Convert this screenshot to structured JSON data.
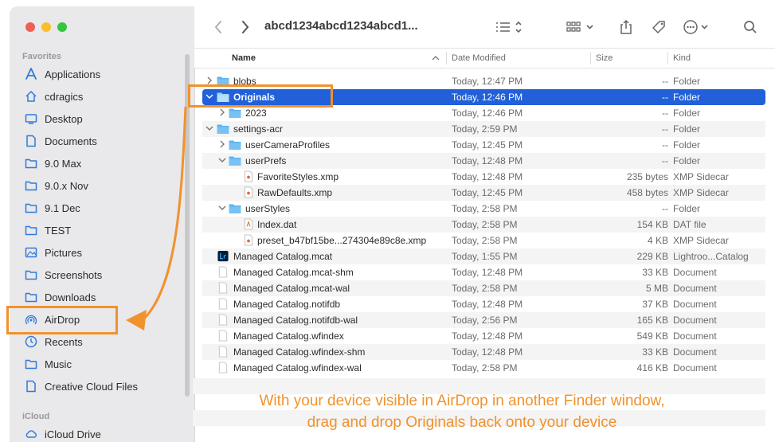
{
  "window": {
    "title": "abcd1234abcd1234abcd1..."
  },
  "sidebar": {
    "favorites_label": "Favorites",
    "icloud_label": "iCloud",
    "items": [
      {
        "label": "Applications",
        "icon": "applications-icon"
      },
      {
        "label": "cdragics",
        "icon": "home-icon"
      },
      {
        "label": "Desktop",
        "icon": "desktop-icon"
      },
      {
        "label": "Documents",
        "icon": "document-icon"
      },
      {
        "label": "9.0 Max",
        "icon": "folder-icon"
      },
      {
        "label": "9.0.x Nov",
        "icon": "folder-icon"
      },
      {
        "label": "9.1 Dec",
        "icon": "folder-icon"
      },
      {
        "label": "TEST",
        "icon": "folder-icon"
      },
      {
        "label": "Pictures",
        "icon": "pictures-icon"
      },
      {
        "label": "Screenshots",
        "icon": "folder-icon"
      },
      {
        "label": "Downloads",
        "icon": "folder-icon"
      },
      {
        "label": "AirDrop",
        "icon": "airdrop-icon"
      },
      {
        "label": "Recents",
        "icon": "clock-icon"
      },
      {
        "label": "Music",
        "icon": "folder-icon"
      },
      {
        "label": "Creative Cloud Files",
        "icon": "document-icon"
      }
    ],
    "icloud_items": [
      {
        "label": "iCloud Drive",
        "icon": "cloud-icon"
      }
    ]
  },
  "columns": {
    "name": "Name",
    "date": "Date Modified",
    "size": "Size",
    "kind": "Kind"
  },
  "files": [
    {
      "name": "blobs",
      "date": "Today, 12:47 PM",
      "size": "--",
      "kind": "Folder"
    },
    {
      "name": "Originals",
      "date": "Today, 12:46 PM",
      "size": "--",
      "kind": "Folder"
    },
    {
      "name": "2023",
      "date": "Today, 12:46 PM",
      "size": "--",
      "kind": "Folder"
    },
    {
      "name": "settings-acr",
      "date": "Today, 2:59 PM",
      "size": "--",
      "kind": "Folder"
    },
    {
      "name": "userCameraProfiles",
      "date": "Today, 12:45 PM",
      "size": "--",
      "kind": "Folder"
    },
    {
      "name": "userPrefs",
      "date": "Today, 12:48 PM",
      "size": "--",
      "kind": "Folder"
    },
    {
      "name": "FavoriteStyles.xmp",
      "date": "Today, 12:48 PM",
      "size": "235 bytes",
      "kind": "XMP Sidecar"
    },
    {
      "name": "RawDefaults.xmp",
      "date": "Today, 12:45 PM",
      "size": "458 bytes",
      "kind": "XMP Sidecar"
    },
    {
      "name": "userStyles",
      "date": "Today, 2:58 PM",
      "size": "--",
      "kind": "Folder"
    },
    {
      "name": "Index.dat",
      "date": "Today, 2:58 PM",
      "size": "154 KB",
      "kind": "DAT file"
    },
    {
      "name": "preset_b47bf15be...274304e89c8e.xmp",
      "date": "Today, 2:58 PM",
      "size": "4 KB",
      "kind": "XMP Sidecar"
    },
    {
      "name": "Managed Catalog.mcat",
      "date": "Today, 1:55 PM",
      "size": "229 KB",
      "kind": "Lightroo...Catalog"
    },
    {
      "name": "Managed Catalog.mcat-shm",
      "date": "Today, 12:48 PM",
      "size": "33 KB",
      "kind": "Document"
    },
    {
      "name": "Managed Catalog.mcat-wal",
      "date": "Today, 2:58 PM",
      "size": "5 MB",
      "kind": "Document"
    },
    {
      "name": "Managed Catalog.notifdb",
      "date": "Today, 12:48 PM",
      "size": "37 KB",
      "kind": "Document"
    },
    {
      "name": "Managed Catalog.notifdb-wal",
      "date": "Today, 2:56 PM",
      "size": "165 KB",
      "kind": "Document"
    },
    {
      "name": "Managed Catalog.wfindex",
      "date": "Today, 12:48 PM",
      "size": "549 KB",
      "kind": "Document"
    },
    {
      "name": "Managed Catalog.wfindex-shm",
      "date": "Today, 12:48 PM",
      "size": "33 KB",
      "kind": "Document"
    },
    {
      "name": "Managed Catalog.wfindex-wal",
      "date": "Today, 2:58 PM",
      "size": "416 KB",
      "kind": "Document"
    }
  ],
  "annotation": {
    "line1": "With your device visible in AirDrop in another Finder window,",
    "line2": "drag and drop Originals back onto your device",
    "color": "#f0922d"
  },
  "colors": {
    "selection": "#2160d8",
    "folder": "#5fb4ef",
    "accent": "#f0922d"
  }
}
